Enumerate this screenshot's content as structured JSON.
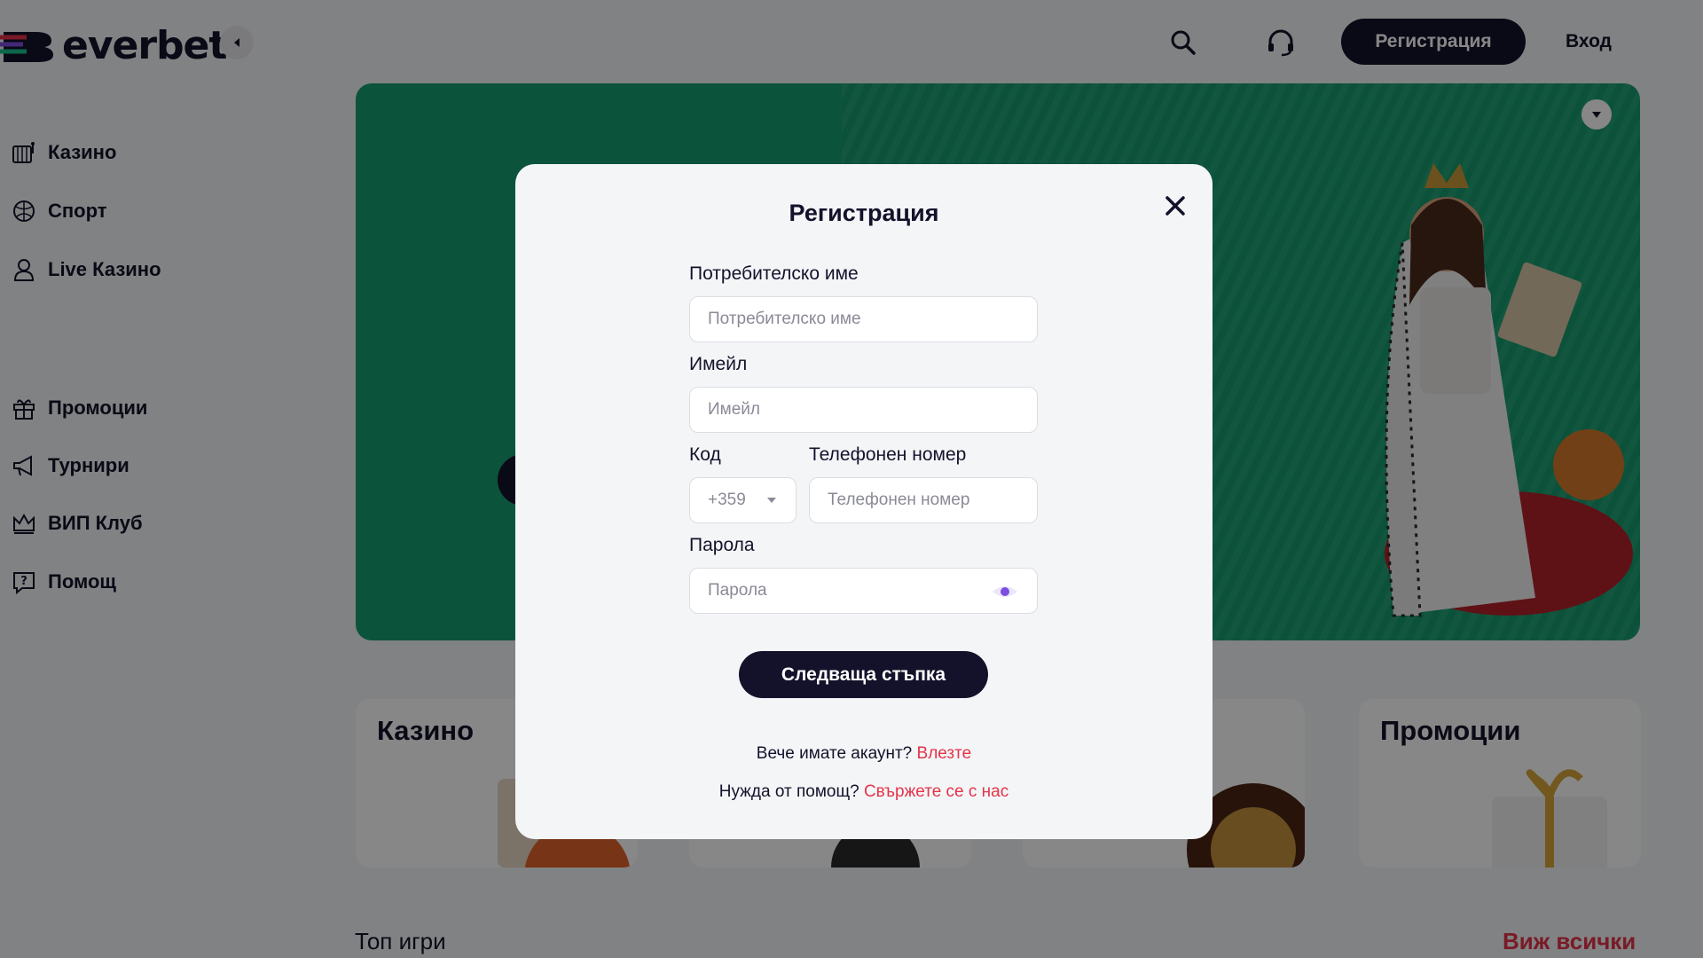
{
  "header": {
    "brand": "everbet",
    "register_label": "Регистрация",
    "login_label": "Вход",
    "icons": [
      "search-icon",
      "headset-icon",
      "chevron-left-icon"
    ]
  },
  "sidebar": {
    "items": [
      {
        "label": "Казино",
        "icon": "slot-machine-icon"
      },
      {
        "label": "Спорт",
        "icon": "ball-icon"
      },
      {
        "label": "Live Казино",
        "icon": "dealer-icon"
      },
      {
        "label": "Промоции",
        "icon": "gift-icon"
      },
      {
        "label": "Турнири",
        "icon": "megaphone-icon"
      },
      {
        "label": "ВИП Клуб",
        "icon": "crown-icon"
      },
      {
        "label": "Помощ",
        "icon": "help-icon"
      }
    ]
  },
  "categories": [
    {
      "title": "Казино"
    },
    {
      "title": "Промоции"
    }
  ],
  "sections": {
    "top_games": "Топ игри",
    "see_all": "Виж всички"
  },
  "modal": {
    "title": "Регистрация",
    "username": {
      "label": "Потребителско име",
      "placeholder": "Потребителско име"
    },
    "email": {
      "label": "Имейл",
      "placeholder": "Имейл"
    },
    "code": {
      "label": "Код",
      "value": "+359"
    },
    "phone": {
      "label": "Телефонен номер",
      "placeholder": "Телефонен номер"
    },
    "password": {
      "label": "Парола",
      "placeholder": "Парола"
    },
    "next_label": "Следваща стъпка",
    "have_account_text": "Вече имате акаунт?",
    "login_link": "Влезте",
    "need_help_text": "Нужда от помощ?",
    "contact_link": "Свържете се с нас"
  },
  "colors": {
    "brand_dark": "#14122b",
    "accent_red": "#e4344a",
    "hero_green": "#189e72",
    "eye_purple": "#7b4fe0"
  }
}
